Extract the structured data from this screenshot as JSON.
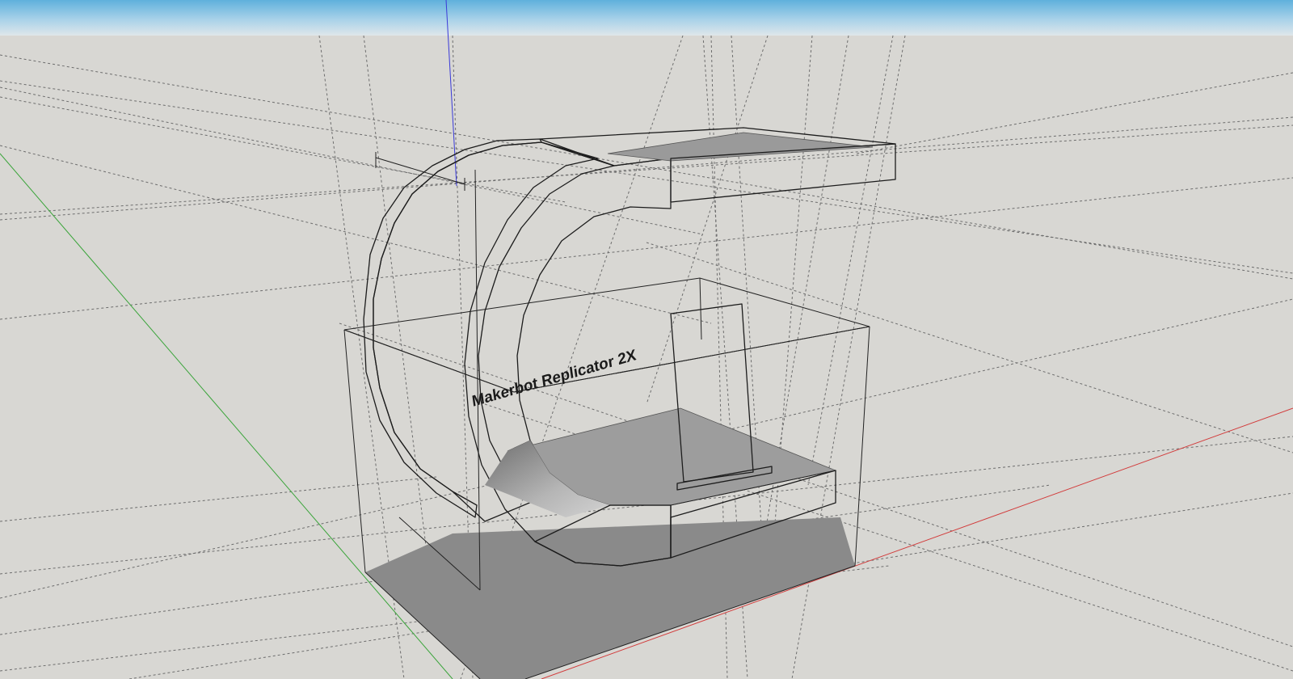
{
  "viewport": {
    "label_text": "Makerbot Replicator 2X"
  },
  "colors": {
    "sky_top": "#6fb7dc",
    "sky_bottom": "#d3e2ea",
    "ground": "#d8d7d3",
    "face_light": "#ffffff",
    "face_shade": "#8f8f8f",
    "face_mid": "#a9a9a9",
    "axis_red": "#d23a3a",
    "axis_green": "#3aa43a",
    "axis_blue": "#3a3ad8",
    "edge": "#1c1c1c"
  },
  "axes": [
    "red-axis",
    "green-axis",
    "blue-axis"
  ],
  "icons": [
    "axis-origin-icon"
  ]
}
